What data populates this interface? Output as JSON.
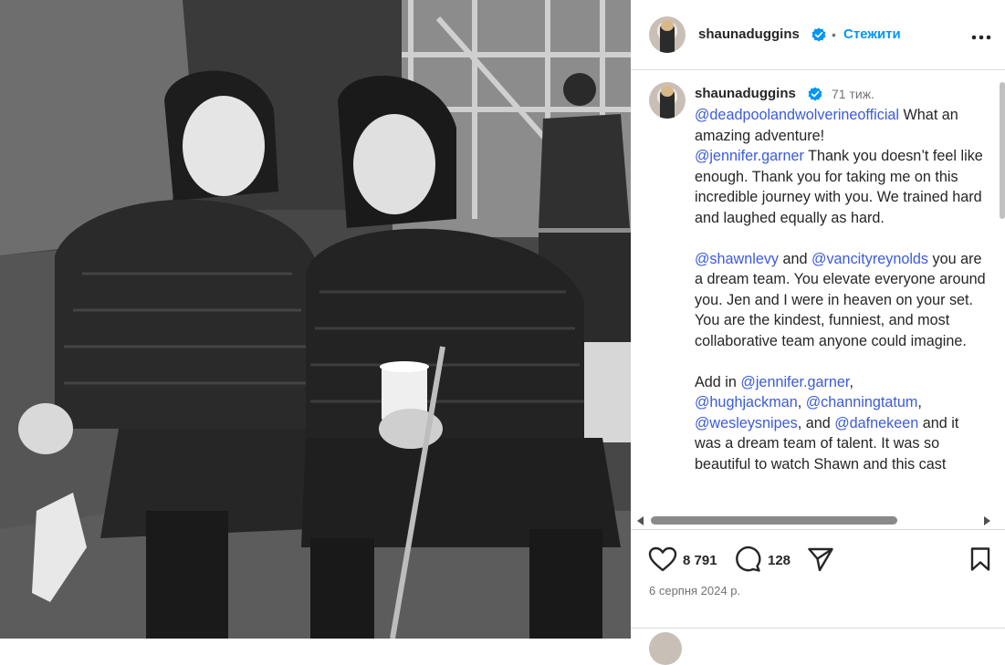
{
  "post": {
    "username": "shaunaduggins",
    "follow_label": "Стежити",
    "separator": "•",
    "more_label": "•••",
    "time_ago": "71 тиж.",
    "caption": {
      "p1": {
        "m1": "@deadpoolandwolverineofficial",
        "t1": " What an amazing adventure!",
        "m2": "@jennifer.garner",
        "t2": " Thank you doesn’t feel like enough. Thank you for taking me on this incredible journey with you. We trained hard and laughed equally as hard."
      },
      "p2": {
        "m1": "@shawnlevy",
        "t1": " and ",
        "m2": "@vancityreynolds",
        "t2": " you are a dream team. You elevate everyone around you. Jen and I were in heaven on your set. You are the kindest, funniest, and most collaborative team anyone could imagine."
      },
      "p3": {
        "t0": "Add in ",
        "m1": "@jennifer.garner",
        "t1": ", ",
        "m2": "@hughjackman",
        "t2": ", ",
        "m3": "@channingtatum",
        "t3": ", ",
        "m4": "@wesleysnipes",
        "t4": ", and ",
        "m5": "@dafnekeen",
        "t5": " and it was a dream team of talent. It was so beautiful to watch Shawn and this cast"
      }
    },
    "likes": "8 791",
    "comments": "128",
    "date": "6 серпня 2024 р."
  },
  "icons": {
    "verified": "verified-badge-icon",
    "like": "heart-icon",
    "comment": "comment-icon",
    "share": "send-icon",
    "save": "bookmark-icon"
  },
  "colors": {
    "link": "#3b5bdb",
    "follow": "#0095f6",
    "verified": "#0095f6",
    "muted": "#737373"
  }
}
